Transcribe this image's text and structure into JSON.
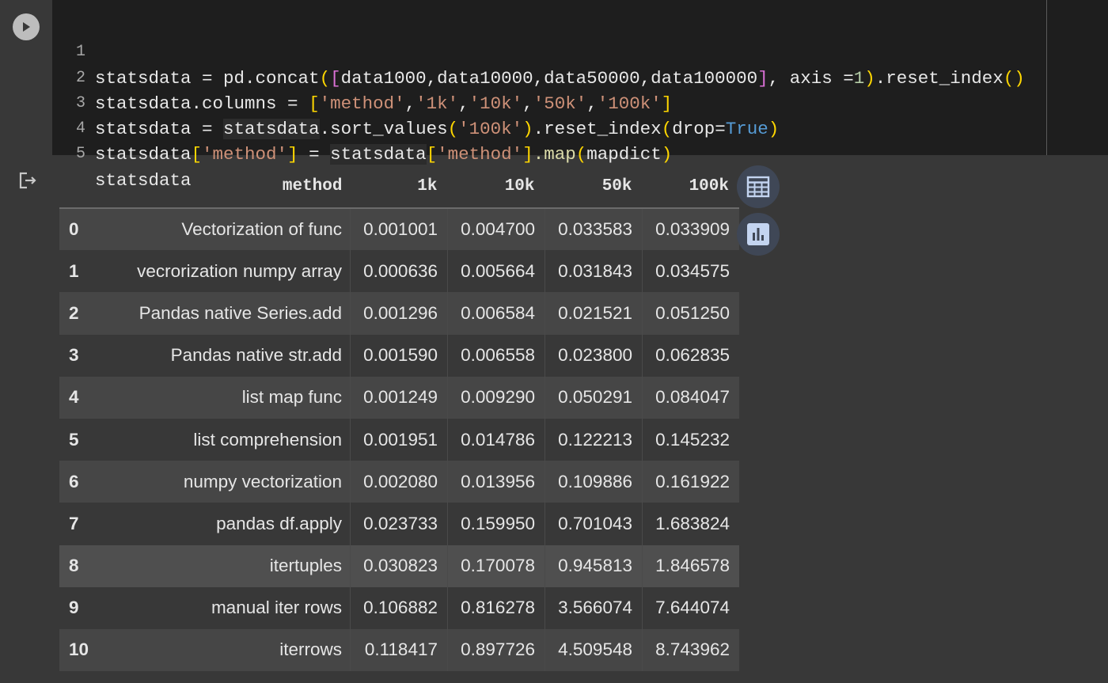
{
  "code_cell": {
    "lines": [
      {
        "no": "1"
      },
      {
        "no": "2"
      },
      {
        "no": "3"
      },
      {
        "no": "4"
      },
      {
        "no": "5"
      }
    ],
    "tokens": {
      "l1_a": "statsdata",
      "l1_b": " = pd.concat",
      "l1_c": "(",
      "l1_d": "[",
      "l1_e": "data1000,data10000,data50000,data100000",
      "l1_f": "]",
      "l1_g": ", axis =",
      "l1_h": "1",
      "l1_i": ")",
      "l1_j": ".reset_index",
      "l1_k": "()",
      "l2_a": "statsdata",
      "l2_b": ".columns = ",
      "l2_c": "[",
      "l2_d": "'method'",
      "l2_e": ",",
      "l2_f": "'1k'",
      "l2_g": ",",
      "l2_h": "'10k'",
      "l2_i": ",",
      "l2_j": "'50k'",
      "l2_k": ",",
      "l2_l": "'100k'",
      "l2_m": "]",
      "l3_a": "statsdata",
      "l3_b": " = ",
      "l3_c": "statsdata",
      "l3_d": ".sort_values",
      "l3_e": "(",
      "l3_f": "'100k'",
      "l3_g": ")",
      "l3_h": ".reset_index",
      "l3_i": "(",
      "l3_j": "drop=",
      "l3_k": "True",
      "l3_l": ")",
      "l4_a": "statsdata",
      "l4_b": "[",
      "l4_c": "'method'",
      "l4_d": "]",
      "l4_e": " = ",
      "l4_f": "statsdata",
      "l4_g": "[",
      "l4_h": "'method'",
      "l4_i": "]",
      "l4_j": ".map",
      "l4_k": "(",
      "l4_l": "mapdict",
      "l4_m": ")",
      "l5_a": "statsdata"
    }
  },
  "output": {
    "columns": [
      "",
      "method",
      "1k",
      "10k",
      "50k",
      "100k"
    ],
    "rows": [
      [
        "0",
        "Vectorization of func",
        "0.001001",
        "0.004700",
        "0.033583",
        "0.033909"
      ],
      [
        "1",
        "vecrorization numpy array",
        "0.000636",
        "0.005664",
        "0.031843",
        "0.034575"
      ],
      [
        "2",
        "Pandas native Series.add",
        "0.001296",
        "0.006584",
        "0.021521",
        "0.051250"
      ],
      [
        "3",
        "Pandas native str.add",
        "0.001590",
        "0.006558",
        "0.023800",
        "0.062835"
      ],
      [
        "4",
        "list map func",
        "0.001249",
        "0.009290",
        "0.050291",
        "0.084047"
      ],
      [
        "5",
        "list comprehension",
        "0.001951",
        "0.014786",
        "0.122213",
        "0.145232"
      ],
      [
        "6",
        "numpy vectorization",
        "0.002080",
        "0.013956",
        "0.109886",
        "0.161922"
      ],
      [
        "7",
        "pandas df.apply",
        "0.023733",
        "0.159950",
        "0.701043",
        "1.683824"
      ],
      [
        "8",
        "itertuples",
        "0.030823",
        "0.170078",
        "0.945813",
        "1.846578"
      ],
      [
        "9",
        "manual iter rows",
        "0.106882",
        "0.816278",
        "3.566074",
        "7.644074"
      ],
      [
        "10",
        "iterrows",
        "0.118417",
        "0.897726",
        "4.509548",
        "8.743962"
      ]
    ],
    "buttons": {
      "table_icon": "table-icon",
      "chart_icon": "bar-chart-icon"
    }
  },
  "colors": {
    "page_bg": "#383838",
    "editor_bg": "#1e1e1e",
    "string": "#ce9178",
    "bracket_yellow": "#ffd700",
    "bracket_magenta": "#da70d6",
    "keyword": "#569cd6",
    "row_odd": "#464646",
    "row_even": "#383838"
  }
}
